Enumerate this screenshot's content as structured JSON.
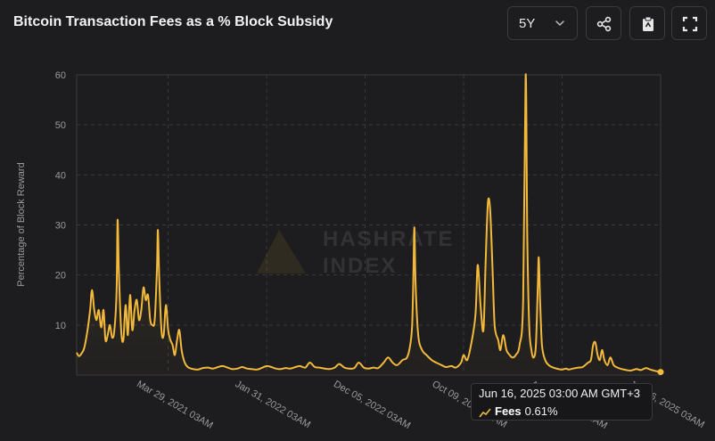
{
  "header": {
    "title": "Bitcoin Transaction Fees as a % Block Subsidy",
    "range": "5Y",
    "actions": [
      {
        "name": "share",
        "icon": "share-icon"
      },
      {
        "name": "copy",
        "icon": "clipboard-icon"
      },
      {
        "name": "fullscreen",
        "icon": "fullscreen-icon"
      }
    ]
  },
  "watermark": {
    "line1": "HASHRATE",
    "line2": "INDEX"
  },
  "tooltip": {
    "date": "Jun 16, 2025 03:00 AM GMT+3",
    "series_name": "Fees",
    "value": "0.61%"
  },
  "colors": {
    "line": "#f2b93b",
    "grid": "#3a3a3e",
    "background": "#1d1d1f",
    "text": "#9a9a9e"
  },
  "chart_data": {
    "type": "line",
    "ylabel": "Percentage of Block Reward",
    "xlabel": "",
    "ylim": [
      0,
      60
    ],
    "yticks": [
      10,
      20,
      30,
      40,
      50,
      60
    ],
    "x_start": "2020-06-16",
    "x_end": "2025-06-16",
    "xticks": [
      {
        "date": "2021-03-29",
        "label": "Mar 29, 2021 03AM"
      },
      {
        "date": "2022-01-31",
        "label": "Jan 31, 2022 03AM"
      },
      {
        "date": "2022-12-05",
        "label": "Dec 05, 2022 03AM"
      },
      {
        "date": "2023-10-09",
        "label": "Oct 09, 2023 03AM"
      },
      {
        "date": "2024-08-12",
        "label": "Aug 12, 2024 03AM"
      },
      {
        "date": "2025-06-16",
        "label": "Jun 16, 2025 03AM"
      }
    ],
    "series": [
      {
        "name": "Fees",
        "points": [
          [
            "2020-06-16",
            4.5
          ],
          [
            "2020-06-23",
            3.8
          ],
          [
            "2020-07-01",
            4.3
          ],
          [
            "2020-07-10",
            5.5
          ],
          [
            "2020-07-20",
            9
          ],
          [
            "2020-07-28",
            13
          ],
          [
            "2020-08-03",
            17
          ],
          [
            "2020-08-10",
            13
          ],
          [
            "2020-08-17",
            11
          ],
          [
            "2020-08-24",
            13
          ],
          [
            "2020-09-01",
            9.5
          ],
          [
            "2020-09-08",
            13
          ],
          [
            "2020-09-14",
            7
          ],
          [
            "2020-09-21",
            8
          ],
          [
            "2020-09-28",
            10
          ],
          [
            "2020-10-05",
            7.5
          ],
          [
            "2020-10-12",
            9
          ],
          [
            "2020-10-19",
            17
          ],
          [
            "2020-10-22",
            31
          ],
          [
            "2020-10-26",
            21
          ],
          [
            "2020-11-02",
            9
          ],
          [
            "2020-11-09",
            7
          ],
          [
            "2020-11-16",
            14
          ],
          [
            "2020-11-23",
            8
          ],
          [
            "2020-11-30",
            16
          ],
          [
            "2020-12-07",
            9
          ],
          [
            "2020-12-14",
            13
          ],
          [
            "2020-12-21",
            15
          ],
          [
            "2020-12-28",
            11
          ],
          [
            "2021-01-04",
            13
          ],
          [
            "2021-01-11",
            17.5
          ],
          [
            "2021-01-18",
            15
          ],
          [
            "2021-01-25",
            16
          ],
          [
            "2021-02-01",
            11
          ],
          [
            "2021-02-08",
            10
          ],
          [
            "2021-02-15",
            11
          ],
          [
            "2021-02-22",
            21
          ],
          [
            "2021-02-25",
            29
          ],
          [
            "2021-03-01",
            20
          ],
          [
            "2021-03-08",
            9
          ],
          [
            "2021-03-15",
            8
          ],
          [
            "2021-03-22",
            14
          ],
          [
            "2021-03-29",
            9
          ],
          [
            "2021-04-05",
            7
          ],
          [
            "2021-04-12",
            6
          ],
          [
            "2021-04-19",
            4
          ],
          [
            "2021-04-26",
            7
          ],
          [
            "2021-05-03",
            9
          ],
          [
            "2021-05-10",
            5
          ],
          [
            "2021-05-17",
            3
          ],
          [
            "2021-05-24",
            2
          ],
          [
            "2021-06-01",
            1.5
          ],
          [
            "2021-06-15",
            1.2
          ],
          [
            "2021-07-01",
            1.1
          ],
          [
            "2021-07-15",
            1.4
          ],
          [
            "2021-08-01",
            1.5
          ],
          [
            "2021-08-15",
            1.3
          ],
          [
            "2021-09-01",
            1.6
          ],
          [
            "2021-09-15",
            1.8
          ],
          [
            "2021-10-01",
            1.5
          ],
          [
            "2021-10-15",
            1.2
          ],
          [
            "2021-11-01",
            1.3
          ],
          [
            "2021-11-15",
            1.6
          ],
          [
            "2021-12-01",
            1.3
          ],
          [
            "2021-12-15",
            1.2
          ],
          [
            "2022-01-01",
            1.1
          ],
          [
            "2022-01-15",
            1.4
          ],
          [
            "2022-01-31",
            1.8
          ],
          [
            "2022-02-15",
            1.6
          ],
          [
            "2022-03-01",
            1.3
          ],
          [
            "2022-03-15",
            1.2
          ],
          [
            "2022-04-01",
            1.4
          ],
          [
            "2022-04-15",
            1.3
          ],
          [
            "2022-05-01",
            1.6
          ],
          [
            "2022-05-15",
            1.8
          ],
          [
            "2022-06-01",
            1.5
          ],
          [
            "2022-06-15",
            2.5
          ],
          [
            "2022-07-01",
            1.6
          ],
          [
            "2022-07-15",
            1.5
          ],
          [
            "2022-08-01",
            1.3
          ],
          [
            "2022-08-15",
            1.2
          ],
          [
            "2022-09-01",
            1.5
          ],
          [
            "2022-09-15",
            2.2
          ],
          [
            "2022-10-01",
            1.5
          ],
          [
            "2022-10-15",
            1.3
          ],
          [
            "2022-11-01",
            1.4
          ],
          [
            "2022-11-15",
            2.5
          ],
          [
            "2022-12-01",
            1.5
          ],
          [
            "2022-12-15",
            1.3
          ],
          [
            "2023-01-01",
            1.5
          ],
          [
            "2023-01-15",
            1.4
          ],
          [
            "2023-02-01",
            2.5
          ],
          [
            "2023-02-15",
            3.5
          ],
          [
            "2023-03-01",
            2.5
          ],
          [
            "2023-03-15",
            2
          ],
          [
            "2023-04-01",
            3
          ],
          [
            "2023-04-15",
            3.5
          ],
          [
            "2023-04-25",
            6
          ],
          [
            "2023-05-01",
            10
          ],
          [
            "2023-05-05",
            20
          ],
          [
            "2023-05-08",
            29.5
          ],
          [
            "2023-05-12",
            18
          ],
          [
            "2023-05-20",
            8
          ],
          [
            "2023-06-01",
            5
          ],
          [
            "2023-06-15",
            4
          ],
          [
            "2023-07-01",
            3
          ],
          [
            "2023-07-15",
            2.5
          ],
          [
            "2023-08-01",
            2
          ],
          [
            "2023-08-15",
            1.6
          ],
          [
            "2023-09-01",
            1.8
          ],
          [
            "2023-09-15",
            1.5
          ],
          [
            "2023-10-01",
            2.5
          ],
          [
            "2023-10-09",
            4
          ],
          [
            "2023-10-20",
            3
          ],
          [
            "2023-11-01",
            6
          ],
          [
            "2023-11-15",
            12
          ],
          [
            "2023-11-22",
            22
          ],
          [
            "2023-12-01",
            14
          ],
          [
            "2023-12-10",
            9
          ],
          [
            "2023-12-17",
            23
          ],
          [
            "2023-12-24",
            34.5
          ],
          [
            "2023-12-31",
            33
          ],
          [
            "2024-01-07",
            22
          ],
          [
            "2024-01-14",
            10
          ],
          [
            "2024-01-25",
            7
          ],
          [
            "2024-02-01",
            5
          ],
          [
            "2024-02-10",
            8
          ],
          [
            "2024-02-20",
            5
          ],
          [
            "2024-03-01",
            4
          ],
          [
            "2024-03-10",
            3.5
          ],
          [
            "2024-03-20",
            4
          ],
          [
            "2024-04-01",
            6
          ],
          [
            "2024-04-12",
            15
          ],
          [
            "2024-04-20",
            60
          ],
          [
            "2024-04-25",
            28
          ],
          [
            "2024-05-01",
            10
          ],
          [
            "2024-05-08",
            5
          ],
          [
            "2024-05-15",
            3.5
          ],
          [
            "2024-05-22",
            6
          ],
          [
            "2024-05-28",
            18
          ],
          [
            "2024-05-31",
            23.5
          ],
          [
            "2024-06-04",
            15
          ],
          [
            "2024-06-10",
            6
          ],
          [
            "2024-06-20",
            3
          ],
          [
            "2024-07-01",
            2
          ],
          [
            "2024-07-15",
            1.5
          ],
          [
            "2024-08-01",
            1.2
          ],
          [
            "2024-08-12",
            1.1
          ],
          [
            "2024-08-25",
            1.3
          ],
          [
            "2024-09-01",
            1.1
          ],
          [
            "2024-09-15",
            1.3
          ],
          [
            "2024-10-01",
            1.5
          ],
          [
            "2024-10-15",
            1.6
          ],
          [
            "2024-11-01",
            2.5
          ],
          [
            "2024-11-10",
            3
          ],
          [
            "2024-11-17",
            6
          ],
          [
            "2024-11-24",
            6.5
          ],
          [
            "2024-12-01",
            4
          ],
          [
            "2024-12-08",
            3
          ],
          [
            "2024-12-15",
            5
          ],
          [
            "2024-12-22",
            3
          ],
          [
            "2025-01-01",
            2
          ],
          [
            "2025-01-10",
            3.5
          ],
          [
            "2025-01-20",
            2
          ],
          [
            "2025-02-01",
            1.5
          ],
          [
            "2025-02-15",
            1.2
          ],
          [
            "2025-03-01",
            1.0
          ],
          [
            "2025-03-15",
            0.9
          ],
          [
            "2025-04-01",
            1.2
          ],
          [
            "2025-04-15",
            1.0
          ],
          [
            "2025-05-01",
            1.4
          ],
          [
            "2025-05-15",
            1.1
          ],
          [
            "2025-06-01",
            0.8
          ],
          [
            "2025-06-16",
            0.61
          ]
        ]
      }
    ],
    "grid": true,
    "legend": "none"
  }
}
